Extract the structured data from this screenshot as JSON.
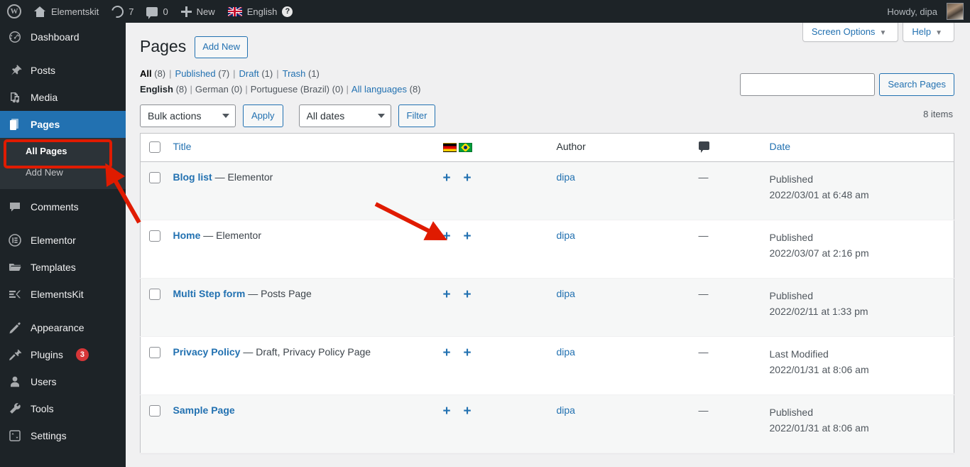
{
  "adminbar": {
    "wp_logo": "wordpress-logo",
    "site_name": "Elementskit",
    "updates_count": "7",
    "comments_count": "0",
    "new_label": "New",
    "language": "English",
    "help_label": "?",
    "howdy": "Howdy, dipa"
  },
  "sidebar": {
    "items": [
      {
        "label": "Dashboard",
        "icon": "dashboard-icon",
        "current": false
      },
      {
        "label": "Posts",
        "icon": "pin-icon",
        "current": false
      },
      {
        "label": "Media",
        "icon": "media-icon",
        "current": false
      },
      {
        "label": "Pages",
        "icon": "pages-icon",
        "current": true
      },
      {
        "label": "Comments",
        "icon": "comment-icon",
        "current": false
      },
      {
        "label": "Elementor",
        "icon": "elementor-icon",
        "current": false
      },
      {
        "label": "Templates",
        "icon": "folder-icon",
        "current": false
      },
      {
        "label": "ElementsKit",
        "icon": "elementskit-icon",
        "current": false
      },
      {
        "label": "Appearance",
        "icon": "brush-icon",
        "current": false
      },
      {
        "label": "Plugins",
        "icon": "plug-icon",
        "current": false,
        "badge": "3"
      },
      {
        "label": "Users",
        "icon": "user-icon",
        "current": false
      },
      {
        "label": "Tools",
        "icon": "wrench-icon",
        "current": false
      },
      {
        "label": "Settings",
        "icon": "settings-icon",
        "current": false
      }
    ],
    "submenu": [
      {
        "label": "All Pages",
        "current": true
      },
      {
        "label": "Add New",
        "current": false
      }
    ]
  },
  "screen_meta": {
    "screen_options": "Screen Options",
    "help": "Help",
    "caret": "▼"
  },
  "header": {
    "title": "Pages",
    "add_new": "Add New"
  },
  "status_filters": [
    {
      "label": "All",
      "count": "(8)",
      "current": true
    },
    {
      "label": "Published",
      "count": "(7)",
      "current": false
    },
    {
      "label": "Draft",
      "count": "(1)",
      "current": false
    },
    {
      "label": "Trash",
      "count": "(1)",
      "current": false
    }
  ],
  "language_filters": [
    {
      "label": "English",
      "count": "(8)",
      "current": true,
      "link": false
    },
    {
      "label": "German",
      "count": "(0)",
      "current": false,
      "link": false
    },
    {
      "label": "Portuguese (Brazil)",
      "count": "(0)",
      "current": false,
      "link": false
    },
    {
      "label": "All languages",
      "count": "(8)",
      "current": false,
      "link": true
    }
  ],
  "tablenav": {
    "bulk_actions_selected": "Bulk actions",
    "apply_label": "Apply",
    "dates_selected": "All dates",
    "filter_label": "Filter",
    "search_value": "",
    "search_placeholder": "",
    "search_button": "Search Pages",
    "items_count": "8 items"
  },
  "table": {
    "columns": {
      "title": "Title",
      "languages": [
        "german-flag",
        "brazil-flag"
      ],
      "author": "Author",
      "comments": "comment-icon",
      "date": "Date"
    },
    "rows": [
      {
        "title": "Blog list",
        "state": "— Elementor",
        "translations": [
          "+",
          "+"
        ],
        "author": "dipa",
        "comments": "—",
        "date_status": "Published",
        "date_value": "2022/03/01 at 6:48 am"
      },
      {
        "title": "Home",
        "state": "— Elementor",
        "translations": [
          "+",
          "+"
        ],
        "author": "dipa",
        "comments": "—",
        "date_status": "Published",
        "date_value": "2022/03/07 at 2:16 pm"
      },
      {
        "title": "Multi Step form",
        "state": "— Posts Page",
        "translations": [
          "+",
          "+"
        ],
        "author": "dipa",
        "comments": "—",
        "date_status": "Published",
        "date_value": "2022/02/11 at 1:33 pm"
      },
      {
        "title": "Privacy Policy",
        "state": "— Draft, Privacy Policy Page",
        "translations": [
          "+",
          "+"
        ],
        "author": "dipa",
        "comments": "—",
        "date_status": "Last Modified",
        "date_value": "2022/01/31 at 8:06 am"
      },
      {
        "title": "Sample Page",
        "state": "",
        "translations": [
          "+",
          "+"
        ],
        "author": "dipa",
        "comments": "—",
        "date_status": "Published",
        "date_value": "2022/01/31 at 8:06 am"
      }
    ]
  },
  "annotations": {
    "color": "#e01b00",
    "highlight_target": "All Pages",
    "arrow_target": "translation-plus-icon-home-row"
  }
}
